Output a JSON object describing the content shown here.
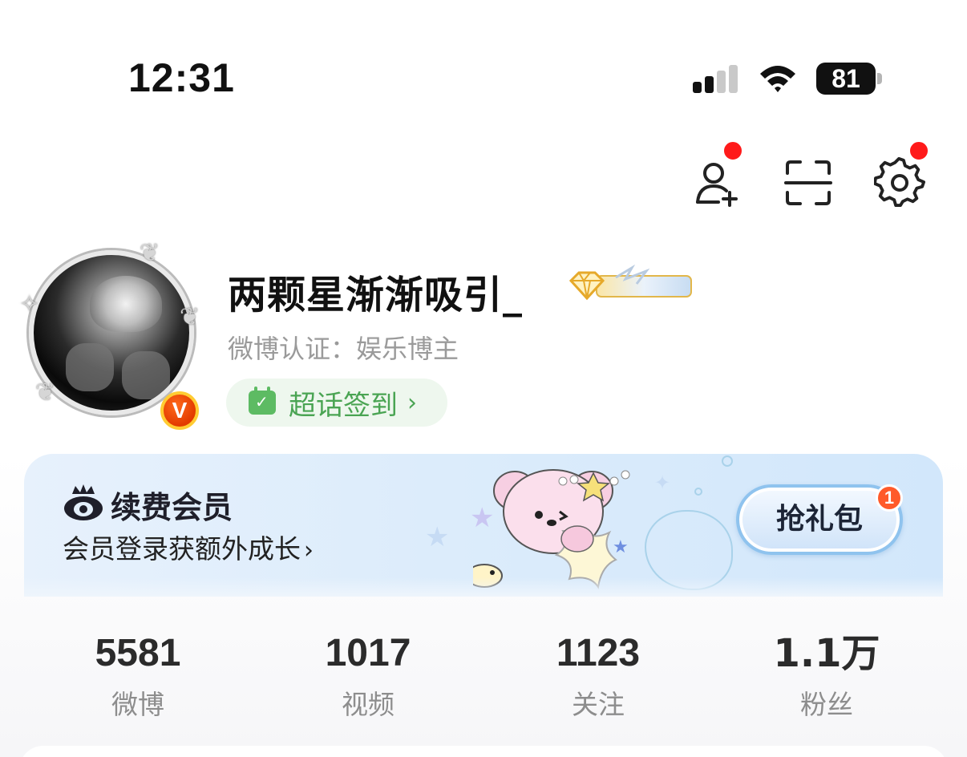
{
  "status_bar": {
    "time": "12:31",
    "battery": "81"
  },
  "header_actions": {
    "add_friend_icon": "add-friend-icon",
    "scan_icon": "scan-icon",
    "settings_icon": "gear-icon"
  },
  "profile": {
    "username": "两颗星渐渐吸引_",
    "verified_badge": "V",
    "certification": "微博认证：娱乐博主",
    "checkin_label": "超话签到",
    "checkin_chevron": "›"
  },
  "vip_banner": {
    "title": "续费会员",
    "subtitle": "会员登录获额外成长",
    "subtitle_chevron": "›",
    "button_label": "抢礼包",
    "button_badge": "1"
  },
  "stats": [
    {
      "value": "5581",
      "label": "微博"
    },
    {
      "value": "1017",
      "label": "视频"
    },
    {
      "value": "1123",
      "label": "关注"
    },
    {
      "value": "1.1万",
      "label": "粉丝"
    }
  ],
  "colors": {
    "notification_red": "#ff1a1a",
    "checkin_green": "#4aa453",
    "vip_blue": "#8fc3ee",
    "badge_orange": "#ff5a2a"
  }
}
